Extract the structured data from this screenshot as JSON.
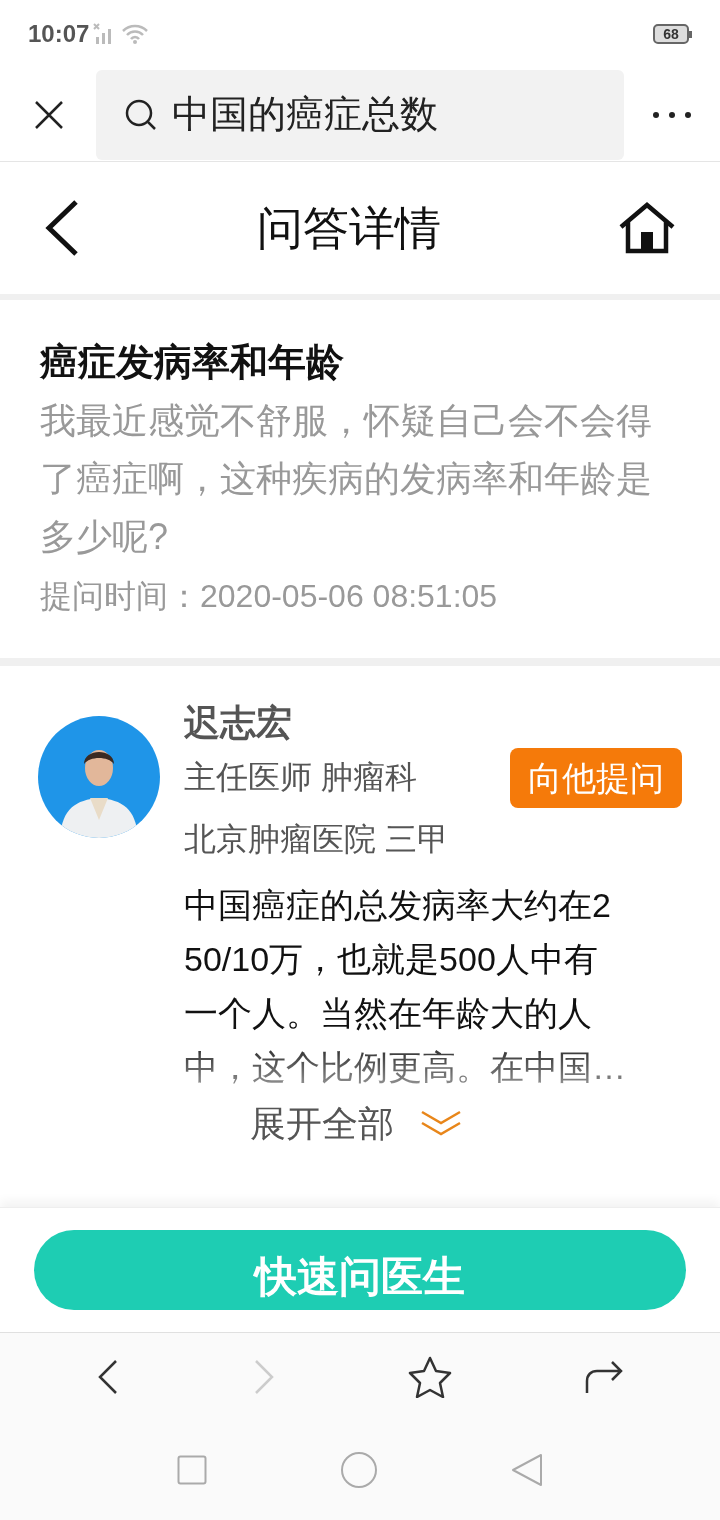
{
  "status_bar": {
    "time": "10:07",
    "battery": "68"
  },
  "search": {
    "value": "中国的癌症总数"
  },
  "header": {
    "title": "问答详情"
  },
  "question": {
    "title": "癌症发病率和年龄",
    "body": "我最近感觉不舒服，怀疑自己会不会得了癌症啊，这种疾病的发病率和年龄是多少呢?",
    "time": "提问时间：2020-05-06 08:51:05"
  },
  "answer": {
    "doctor": "迟志宏",
    "title": "主任医师 肿瘤科",
    "hospital": "北京肿瘤医院 三甲",
    "ask_button": "向他提问",
    "text_lines": [
      "中国癌症的总发病率大约在2",
      "50/10万，也就是500人中有",
      "一个人。当然在年龄大的人",
      "中，这个比例更高。在中国…"
    ],
    "expand": "展开全部"
  },
  "cta": "快速问医生",
  "browser_nav": [
    {
      "kind": "back",
      "disabled": false
    },
    {
      "kind": "forward",
      "disabled": true
    },
    {
      "kind": "star",
      "disabled": false
    },
    {
      "kind": "share",
      "disabled": false
    }
  ]
}
